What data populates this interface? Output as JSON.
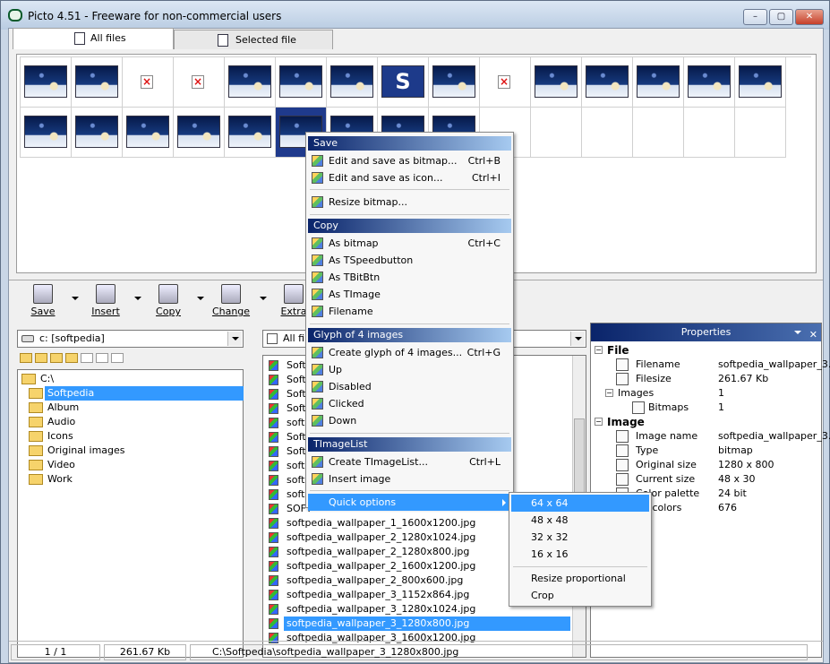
{
  "window": {
    "title": "Picto 4.51 - Freeware for non-commercial users"
  },
  "tabs": [
    {
      "label": "All files"
    },
    {
      "label": "Selected file"
    }
  ],
  "toolbar": {
    "save": "Save",
    "insert": "Insert",
    "copy": "Copy",
    "change": "Change",
    "extra": "Extra"
  },
  "drive": {
    "value": "c: [softpedia]"
  },
  "folders": {
    "root": "C:\\",
    "selected": "Softpedia",
    "items": [
      "Album",
      "Audio",
      "Icons",
      "Original images",
      "Video",
      "Work"
    ]
  },
  "filter": {
    "value": "All files"
  },
  "files": {
    "partial": [
      "Softp",
      "Softp",
      "Softp",
      "Softp",
      "softp",
      "Softp",
      "Softp",
      "softp",
      "softp",
      "softp",
      "SOFT"
    ],
    "full": [
      "softpedia_wallpaper_1_1600x1200.jpg",
      "softpedia_wallpaper_2_1280x1024.jpg",
      "softpedia_wallpaper_2_1280x800.jpg",
      "softpedia_wallpaper_2_1600x1200.jpg",
      "softpedia_wallpaper_2_800x600.jpg",
      "softpedia_wallpaper_3_1152x864.jpg",
      "softpedia_wallpaper_3_1280x1024.jpg",
      "softpedia_wallpaper_3_1280x800.jpg",
      "softpedia_wallpaper_3_1600x1200.jpg"
    ]
  },
  "properties": {
    "title": "Properties",
    "file_section": "File",
    "filename_label": "Filename",
    "filename_value": "softpedia_wallpaper_3...",
    "filesize_label": "Filesize",
    "filesize_value": "261.67 Kb",
    "images_label": "Images",
    "images_value": "1",
    "bitmaps_label": "Bitmaps",
    "bitmaps_value": "1",
    "image_section": "Image",
    "imagename_label": "Image name",
    "imagename_value": "softpedia_wallpaper_3...",
    "type_label": "Type",
    "type_value": "bitmap",
    "origsize_label": "Original size",
    "origsize_value": "1280 x 800",
    "cursize_label": "Current size",
    "cursize_value": "48 x 30",
    "palette_label": "Color palette",
    "palette_value": "24 bit",
    "usedcolors_label": "d colors",
    "usedcolors_value": "676"
  },
  "status": {
    "index": "1 / 1",
    "size": "261.67 Kb",
    "path": "C:\\Softpedia\\softpedia_wallpaper_3_1280x800.jpg"
  },
  "menu": {
    "save_header": "Save",
    "edit_bitmap": "Edit and save as bitmap...",
    "edit_bitmap_sc": "Ctrl+B",
    "edit_icon": "Edit and save as icon...",
    "edit_icon_sc": "Ctrl+I",
    "resize_bitmap": "Resize bitmap...",
    "copy_header": "Copy",
    "as_bitmap": "As bitmap",
    "as_bitmap_sc": "Ctrl+C",
    "as_tspeedbutton": "As TSpeedbutton",
    "as_tbitbtn": "As TBitBtn",
    "as_timage": "As TImage",
    "filename": "Filename",
    "glyph_header": "Glyph of 4 images",
    "create_glyph": "Create glyph of 4 images...",
    "create_glyph_sc": "Ctrl+G",
    "up": "Up",
    "disabled": "Disabled",
    "clicked": "Clicked",
    "down": "Down",
    "imagelist_header": "TImageList",
    "create_imagelist": "Create TImageList...",
    "create_imagelist_sc": "Ctrl+L",
    "insert_image": "Insert image",
    "quick_options": "Quick options"
  },
  "submenu": {
    "s64": "64 x 64",
    "s48": "48 x 48",
    "s32": "32 x 32",
    "s16": "16 x 16",
    "resize_prop": "Resize proportional",
    "crop": "Crop"
  }
}
